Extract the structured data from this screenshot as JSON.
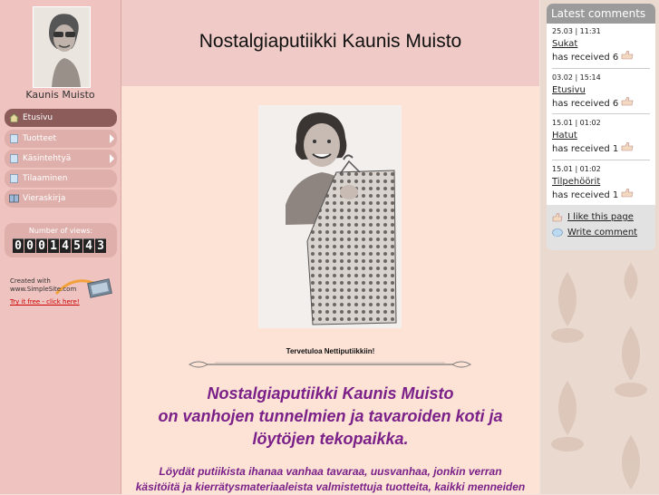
{
  "sidebar": {
    "site_name": "Kaunis Muisto",
    "nav": [
      {
        "label": "Etusivu",
        "icon": "home-icon",
        "active": true
      },
      {
        "label": "Tuotteet",
        "icon": "page-icon",
        "submenu": true
      },
      {
        "label": "Käsintehtyä",
        "icon": "page-icon",
        "submenu": true
      },
      {
        "label": "Tilaaminen",
        "icon": "page-icon"
      },
      {
        "label": "Vieraskirja",
        "icon": "guestbook-icon"
      }
    ],
    "views_label": "Number of views:",
    "views_digits": [
      "0",
      "0",
      "0",
      "1",
      "4",
      "5",
      "4",
      "3"
    ],
    "created_line1": "Created with",
    "created_line2": "www.SimpleSite.com",
    "try_it": "Try it free - click here!"
  },
  "header": {
    "title": "Nostalgiaputiikki Kaunis Muisto"
  },
  "content": {
    "welcome": "Tervetuloa Nettiputiikkiin!",
    "headline": [
      "Nostalgiaputiikki Kaunis Muisto",
      "on vanhojen tunnelmien ja tavaroiden koti ja",
      "löytöjen tekopaikka."
    ],
    "body": [
      "Löydät putiikista ihanaa vanhaa tavaraa, uusvanhaa, jonkin verran",
      "käsitöitä ja kierrätysmateriaaleista valmistettuja tuotteita, kaikki menneiden"
    ]
  },
  "comments": {
    "title": "Latest comments",
    "items": [
      {
        "when": "25.03 | 11:31",
        "title": "Sukat",
        "received": "has received 6"
      },
      {
        "when": "03.02 | 15:14",
        "title": "Etusivu",
        "received": "has received 6"
      },
      {
        "when": "15.01 | 01:02",
        "title": "Hatut",
        "received": "has received 1"
      },
      {
        "when": "15.01 | 01:02",
        "title": "Tilpehöörit",
        "received": "has received 1"
      }
    ],
    "like_label": "I like this page",
    "write_label": "Write comment"
  },
  "colors": {
    "sidebar_bg": "#efc3bf",
    "nav_active": "#8c5c5a",
    "header_bg": "#efcac6",
    "content_bg": "#fde3d6",
    "headline_purple": "#7a2088"
  }
}
